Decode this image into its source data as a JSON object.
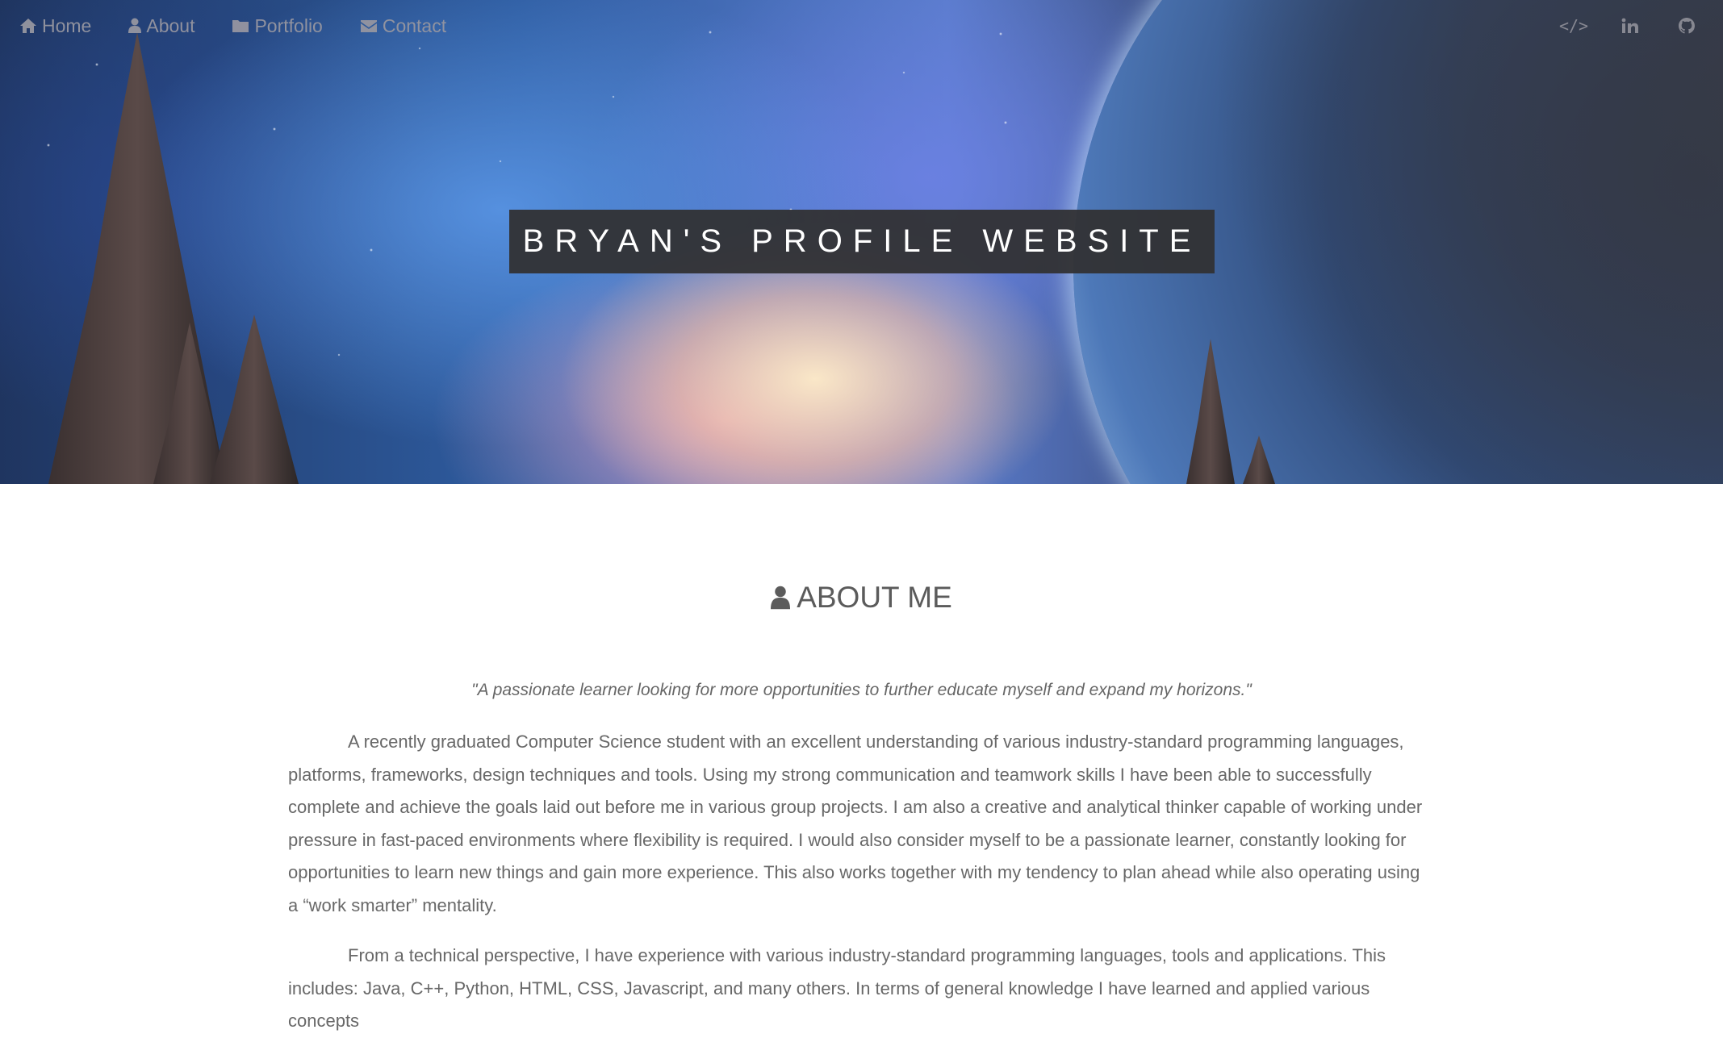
{
  "nav": {
    "links": [
      {
        "label": "Home",
        "icon": "home-icon"
      },
      {
        "label": "About",
        "icon": "user-icon"
      },
      {
        "label": "Portfolio",
        "icon": "folder-icon"
      },
      {
        "label": "Contact",
        "icon": "envelope-icon"
      }
    ],
    "social": [
      {
        "icon": "code-icon",
        "glyph": "</>"
      },
      {
        "icon": "linkedin-icon",
        "glyph": "in"
      },
      {
        "icon": "github-icon"
      }
    ]
  },
  "hero": {
    "title": "BRYAN'S PROFILE WEBSITE"
  },
  "about": {
    "heading": "ABOUT ME",
    "heading_icon": "user-icon",
    "quote": "\"A passionate learner looking for more opportunities to further educate myself and expand my horizons.\"",
    "paragraphs": [
      "A recently graduated Computer Science student with an excellent understanding of various industry-standard programming languages, platforms, frameworks, design techniques and tools. Using my strong communication and teamwork skills I have been able to successfully complete and achieve the goals laid out before me in various group projects. I am also a creative and analytical thinker capable of working under pressure in fast-paced environments where flexibility is required. I would also consider myself to be a passionate learner, constantly looking for opportunities to learn new things and gain more experience. This also works together with my tendency to plan ahead while also operating using a “work smarter” mentality.",
      "From a technical perspective, I have experience with various industry-standard programming languages, tools and applications. This includes: Java, C++, Python, HTML, CSS, Javascript, and many others. In terms of general knowledge I have learned and applied various concepts"
    ]
  },
  "colors": {
    "title_bg": "#323234",
    "text": "#686868",
    "heading": "#5b5b5b"
  }
}
